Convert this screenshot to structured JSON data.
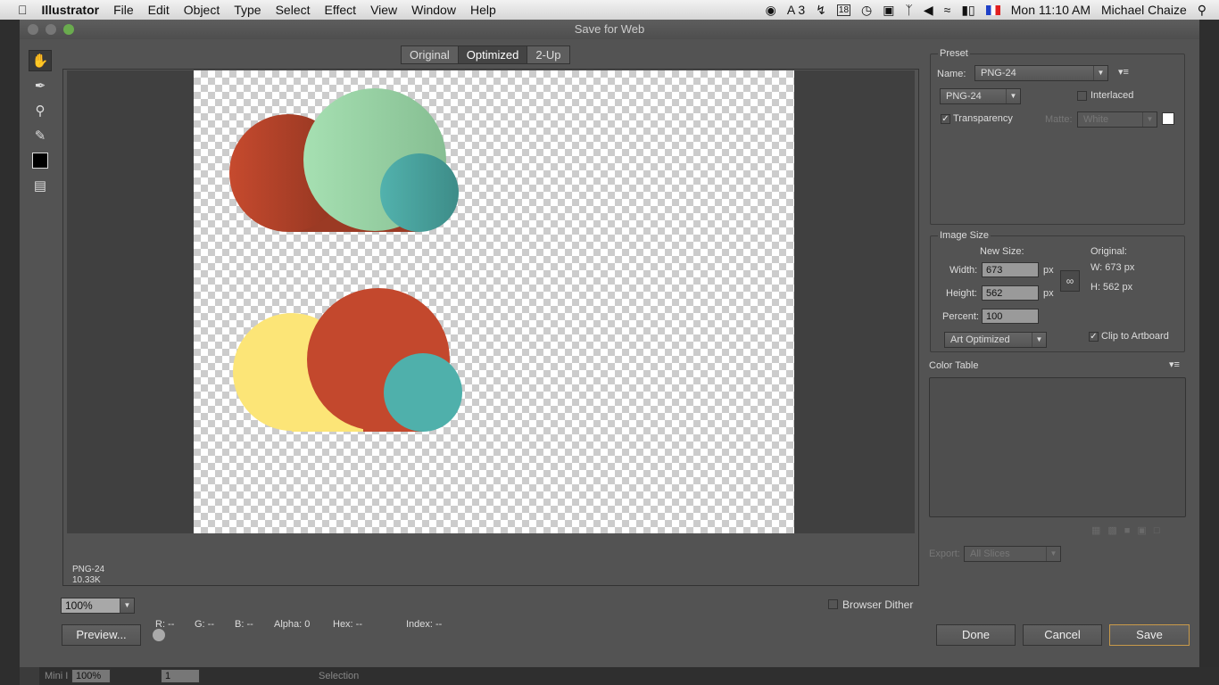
{
  "menubar": {
    "app": "Illustrator",
    "items": [
      "File",
      "Edit",
      "Object",
      "Type",
      "Select",
      "Effect",
      "View",
      "Window",
      "Help"
    ],
    "status": {
      "adobe_count": "3",
      "calendar": "18",
      "clock": "Mon 11:10 AM",
      "user": "Michael Chaize"
    }
  },
  "dialog": {
    "title": "Save for Web",
    "tabs": [
      "Original",
      "Optimized",
      "2-Up"
    ],
    "active_tab": "Optimized",
    "preview_info": {
      "format": "PNG-24",
      "size": "10.33K"
    },
    "zoom": "100%",
    "readouts": {
      "r": "R: --",
      "g": "G: --",
      "b": "B: --",
      "alpha": "Alpha: 0",
      "hex": "Hex: --",
      "index": "Index: --"
    },
    "preview_button": "Preview...",
    "browser_dither": "Browser Dither",
    "preset": {
      "title": "Preset",
      "name_label": "Name:",
      "name": "PNG-24",
      "format": "PNG-24",
      "interlaced": "Interlaced",
      "interlaced_checked": false,
      "transparency": "Transparency",
      "transparency_checked": true,
      "matte_label": "Matte:",
      "matte": "White"
    },
    "image_size": {
      "title": "Image Size",
      "new_size": "New Size:",
      "width_label": "Width:",
      "width": "673",
      "height_label": "Height:",
      "height": "562",
      "percent_label": "Percent:",
      "percent": "100",
      "unit": "px",
      "original": "Original:",
      "orig_w": "W:  673 px",
      "orig_h": "H:  562 px",
      "quality": "Art Optimized",
      "clip": "Clip to Artboard",
      "clip_checked": true
    },
    "color_table": {
      "title": "Color Table"
    },
    "export": {
      "label": "Export:",
      "value": "All Slices"
    },
    "buttons": {
      "done": "Done",
      "cancel": "Cancel",
      "save": "Save"
    }
  },
  "bottombar": {
    "label": "Mini I",
    "zoom": "100%",
    "page": "1",
    "tool": "Selection"
  },
  "colors": {
    "red": "#c3482d",
    "green": "#94d3a4",
    "teal": "#4aa8a6",
    "yellow": "#fce577"
  }
}
